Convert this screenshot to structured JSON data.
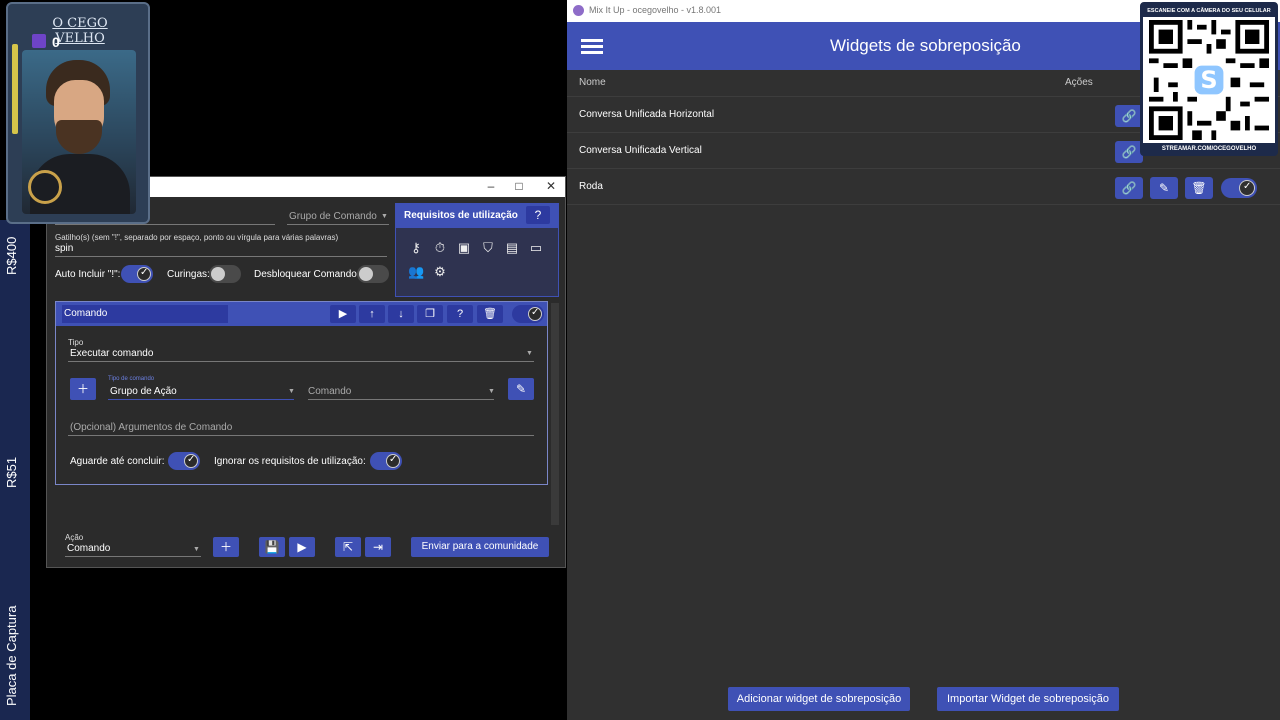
{
  "overlay_card": {
    "name": "O CEGO VELHO",
    "viewer_count": "0"
  },
  "left_bar": {
    "labels": [
      "R$400",
      "R$51",
      "Placa de Captura"
    ]
  },
  "dialog": {
    "group_placeholder": "Grupo de Comando",
    "trigger_label": "Gatilho(s) (sem \"!\", separado por espaço, ponto ou vírgula para várias palavras)",
    "trigger_value": "spin",
    "auto_include_label": "Auto Incluir \"!\":",
    "wildcards_label": "Curingas:",
    "unlock_label": "Desbloquear Comando:",
    "requirements_title": "Requisitos de utilização",
    "command": {
      "name": "Comando",
      "type_label": "Tipo",
      "type_value": "Executar comando",
      "command_type_label": "Tipo de comando",
      "command_type_value": "Grupo de Ação",
      "command_placeholder": "Comando",
      "args_placeholder": "(Opcional) Argumentos de Comando",
      "wait_label": "Aguarde até concluir:",
      "ignore_label": "Ignorar os requisitos de utilização:"
    },
    "action_label": "Ação",
    "action_value": "Comando",
    "send_community_label": "Enviar para a comunidade"
  },
  "app": {
    "window_title": "Mix It Up - ocegovelho - v1.8.001",
    "page_title": "Widgets de sobreposição",
    "col_name": "Nome",
    "col_actions": "Ações",
    "rows": [
      {
        "name": "Conversa Unificada Horizontal"
      },
      {
        "name": "Conversa Unificada Vertical"
      },
      {
        "name": "Roda"
      }
    ],
    "add_button": "Adicionar widget de sobreposição",
    "import_button": "Importar Widget de sobreposição"
  },
  "qr_overlay": {
    "top_text": "ESCANEIE COM A CÂMERA DO SEU CELULAR",
    "bottom_text": "STREAMAR.COM/OCEGOVELHO"
  },
  "colors": {
    "accent": "#3f51b5",
    "app_bg": "#303030",
    "dialog_bg": "#2b2b2b"
  }
}
